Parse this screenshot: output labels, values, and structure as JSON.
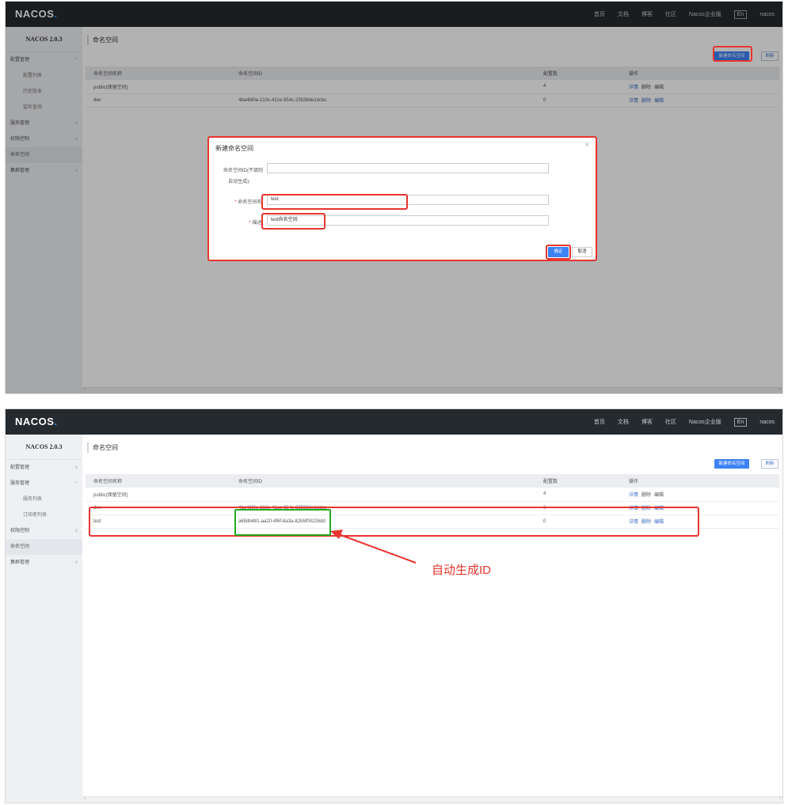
{
  "header": {
    "logo_main": "NACOS",
    "logo_dot": ".",
    "nav": [
      "首页",
      "文档",
      "博客",
      "社区",
      "Nacos企业版"
    ],
    "lang": "En",
    "user": "nacos"
  },
  "shot1": {
    "sidebar": {
      "version": "NACOS 2.0.3",
      "items": [
        {
          "label": "配置管理",
          "chev": "^"
        },
        {
          "label": "配置列表",
          "chev": ""
        },
        {
          "label": "历史版本",
          "chev": ""
        },
        {
          "label": "监听查询",
          "chev": ""
        },
        {
          "label": "服务管理",
          "chev": "v"
        },
        {
          "label": "权限控制",
          "chev": "v"
        },
        {
          "label": "命名空间",
          "chev": ""
        },
        {
          "label": "集群管理",
          "chev": "v"
        }
      ]
    },
    "page_title": "命名空间",
    "buttons": {
      "new": "新建命名空间",
      "delete": "刷新"
    },
    "table": {
      "headers": [
        "命名空间名称",
        "命名空间ID",
        "配置数",
        "操作"
      ],
      "rows": [
        {
          "name": "public(保留空间)",
          "id": "",
          "count": "4",
          "ops": [
            "详情",
            "删除",
            "编辑"
          ]
        },
        {
          "name": "dev",
          "id": "4ba4bf0e-210c-41ce-954c-23538de1dcbc",
          "count": "0",
          "ops": [
            "详情",
            "删除",
            "编辑"
          ]
        }
      ]
    },
    "dialog": {
      "title": "新建命名空间",
      "close": "×",
      "id_label_1": "命名空间ID(不填则",
      "id_label_2": "自动生成):",
      "name_label": "命名空间名:",
      "name_value": "test",
      "desc_label": "描述:",
      "desc_value": "test命名空间",
      "ok": "确定",
      "cancel": "取消",
      "required_mark": "*"
    },
    "scroll": {
      "left": "‹",
      "right": "›"
    }
  },
  "shot2": {
    "sidebar": {
      "version": "NACOS 2.0.3",
      "items": [
        {
          "label": "配置管理",
          "chev": "v"
        },
        {
          "label": "服务管理",
          "chev": "^"
        },
        {
          "label": "服务列表",
          "chev": ""
        },
        {
          "label": "订阅者列表",
          "chev": ""
        },
        {
          "label": "权限控制",
          "chev": "v"
        },
        {
          "label": "命名空间",
          "chev": ""
        },
        {
          "label": "集群管理",
          "chev": "v"
        }
      ]
    },
    "page_title": "命名空间",
    "buttons": {
      "new": "新建命名空间",
      "delete": "刷新"
    },
    "table": {
      "headers": [
        "命名空间名称",
        "命名空间ID",
        "配置数",
        "操作"
      ],
      "rows": [
        {
          "name": "public(保留空间)",
          "id": "",
          "count": "4",
          "ops": [
            "详情",
            "删除",
            "编辑"
          ]
        },
        {
          "name": "dev",
          "id": "4ba4bf0e-210c-41ce-954c-23538de1dcbc",
          "count": "0",
          "ops": [
            "详情",
            "删除",
            "编辑"
          ]
        },
        {
          "name": "test",
          "id": "a69db481-aa20-4f6f-8a3a-82b5f00226dd",
          "count": "0",
          "ops": [
            "详情",
            "删除",
            "编辑"
          ]
        }
      ]
    },
    "annotation": "自动生成ID",
    "scroll": {
      "left": "‹",
      "right": "›"
    }
  },
  "colors": {
    "accent": "#3c82f6",
    "highlight_red": "#e8352e",
    "highlight_green": "#22aa22",
    "topbar": "#252a2f"
  }
}
